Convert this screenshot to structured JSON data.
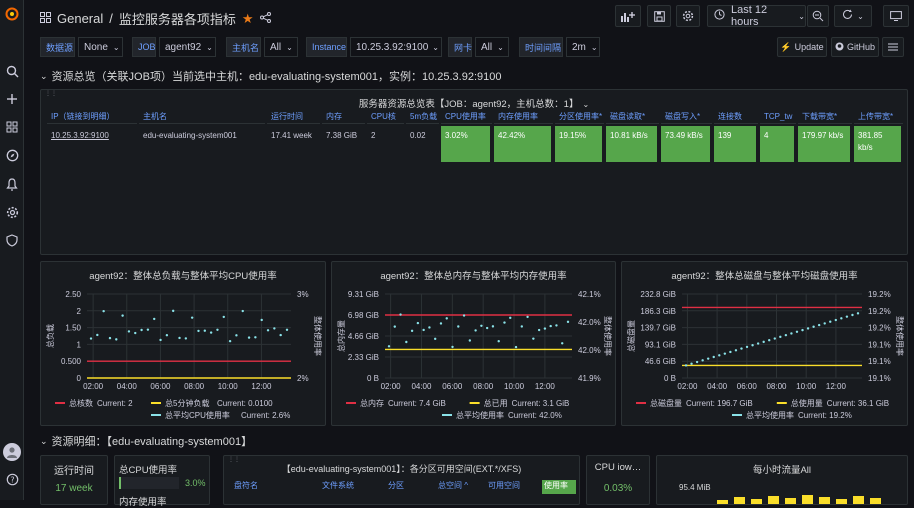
{
  "topbar": {
    "home": "General",
    "sep": "/",
    "title": "监控服务器各项指标",
    "time_range": "Last 12 hours"
  },
  "vars": [
    {
      "label": "数据源",
      "value": "None"
    },
    {
      "label": "JOB",
      "value": "agent92"
    },
    {
      "label": "主机名",
      "value": "All"
    },
    {
      "label": "Instance",
      "value": "10.25.3.92:9100"
    },
    {
      "label": "网卡",
      "value": "All"
    },
    {
      "label": "时间间隔",
      "value": "2m"
    }
  ],
  "links": {
    "update": "Update",
    "github": "GitHub"
  },
  "row1": {
    "title": "资源总览（关联JOB项）当前选中主机：edu-evaluating-system001，实例：10.25.3.92:9100"
  },
  "table_panel": {
    "title": "服务器资源总览表【JOB：agent92，主机总数：1】",
    "headers": [
      "IP（链接到明细）",
      "主机名",
      "运行时间",
      "内存",
      "CPU核",
      "5m负载",
      "CPU使用率",
      "内存使用率",
      "分区使用率*",
      "磁盘读取*",
      "磁盘写入*",
      "连接数",
      "TCP_tw",
      "下载带宽*",
      "上传带宽*"
    ],
    "row": [
      "10.25.3.92:9100",
      "edu-evaluating-system001",
      "17.41 week",
      "7.38 GiB",
      "2",
      "0.02",
      "3.02%",
      "42.42%",
      "19.15%",
      "10.81 kB/s",
      "73.49 kB/s",
      "139",
      "4",
      "179.97 kb/s",
      "381.85 kb/s"
    ]
  },
  "colors": {
    "green": "#56a64b",
    "red": "#e02f44",
    "yellow": "#fade2a",
    "cyan": "#8ae2e8",
    "blue": "#6e9fff"
  },
  "charts": [
    {
      "title": "agent92：整体总负载与整体平均CPU使用率",
      "ylabel_left": "总负载",
      "ylabel_right": "整体使用率",
      "left_ticks": [
        "2.50",
        "2",
        "1.50",
        "1",
        "0.500",
        "0"
      ],
      "right_ticks": [
        "3%",
        "",
        "",
        "",
        "",
        "2%"
      ],
      "x_ticks": [
        "02:00",
        "04:00",
        "06:00",
        "08:00",
        "10:00",
        "12:00"
      ],
      "legend": [
        {
          "name": "总核数",
          "current": "Current: 2",
          "color": "#e02f44"
        },
        {
          "name": "总5分钟负载",
          "current": "Current: 0.0100",
          "color": "#fade2a"
        },
        {
          "name": "总平均CPU使用率",
          "current": "Current: 2.6%",
          "color": "#8ae2e8"
        }
      ]
    },
    {
      "title": "agent92：整体总内存与整体平均内存使用率",
      "ylabel_left": "总内存量",
      "ylabel_right": "整体使用率",
      "left_ticks": [
        "9.31 GiB",
        "6.98 GiB",
        "4.66 GiB",
        "2.33 GiB",
        "0 B"
      ],
      "right_ticks": [
        "42.1%",
        "42.0%",
        "42.0%",
        "41.9%"
      ],
      "x_ticks": [
        "02:00",
        "04:00",
        "06:00",
        "08:00",
        "10:00",
        "12:00"
      ],
      "legend": [
        {
          "name": "总内存",
          "current": "Current: 7.4 GiB",
          "color": "#e02f44"
        },
        {
          "name": "总已用",
          "current": "Current: 3.1 GiB",
          "color": "#fade2a"
        },
        {
          "name": "总平均使用率",
          "current": "Current: 42.0%",
          "color": "#8ae2e8"
        }
      ]
    },
    {
      "title": "agent92：整体总磁盘与整体平均磁盘使用率",
      "ylabel_left": "总磁盘量",
      "ylabel_right": "整体使用率",
      "left_ticks": [
        "232.8 GiB",
        "186.3 GiB",
        "139.7 GiB",
        "93.1 GiB",
        "46.6 GiB",
        "0 B"
      ],
      "right_ticks": [
        "19.2%",
        "19.2%",
        "19.2%",
        "19.1%",
        "19.1%",
        "19.1%"
      ],
      "x_ticks": [
        "02:00",
        "04:00",
        "06:00",
        "08:00",
        "10:00",
        "12:00"
      ],
      "legend": [
        {
          "name": "总磁盘量",
          "current": "Current: 196.7 GiB",
          "color": "#e02f44"
        },
        {
          "name": "总使用量",
          "current": "Current: 36.1 GiB",
          "color": "#fade2a"
        },
        {
          "name": "总平均使用率",
          "current": "Current: 19.2%",
          "color": "#8ae2e8"
        }
      ]
    }
  ],
  "row2": {
    "title": "资源明细：【edu-evaluating-system001】"
  },
  "bottom": {
    "uptime_title": "运行时间",
    "uptime_value": "17 week",
    "cpu_title": "总CPU使用率",
    "cpu_value": "3.0%",
    "mem_title": "内存使用率",
    "fs_title": "【edu-evaluating-system001】：各分区可用空间(EXT.*/XFS)",
    "fs_headers": [
      "盘符名",
      "文件系统",
      "分区",
      "总空间 ^",
      "可用空间",
      "使用率"
    ],
    "iowait_title": "CPU iow…",
    "iowait_value": "0.03%",
    "traffic_title": "每小时流量All",
    "traffic_tick": "95.4 MiB"
  }
}
